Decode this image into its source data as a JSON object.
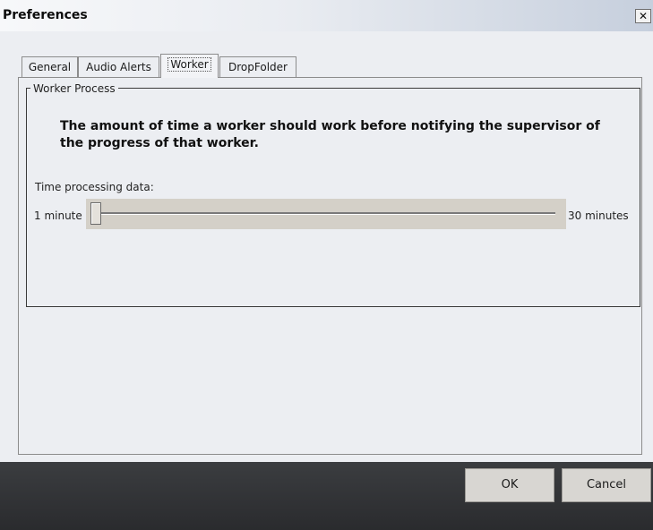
{
  "window": {
    "title": "Preferences",
    "close_glyph": "✕"
  },
  "tabs": [
    {
      "label": "General"
    },
    {
      "label": "Audio Alerts"
    },
    {
      "label": "Worker"
    },
    {
      "label": "DropFolder"
    }
  ],
  "active_tab": "Worker",
  "group": {
    "legend": "Worker Process",
    "description": "The amount of time a worker should work before notifying the supervisor of the progress of that worker."
  },
  "slider": {
    "label": "Time processing data:",
    "min_label": "1 minute",
    "max_label": "30 minutes",
    "value_fraction": 0
  },
  "buttons": {
    "ok": "OK",
    "cancel": "Cancel"
  },
  "colors": {
    "footer": "#2f3033",
    "slider_bg": "#d4d0c8"
  }
}
